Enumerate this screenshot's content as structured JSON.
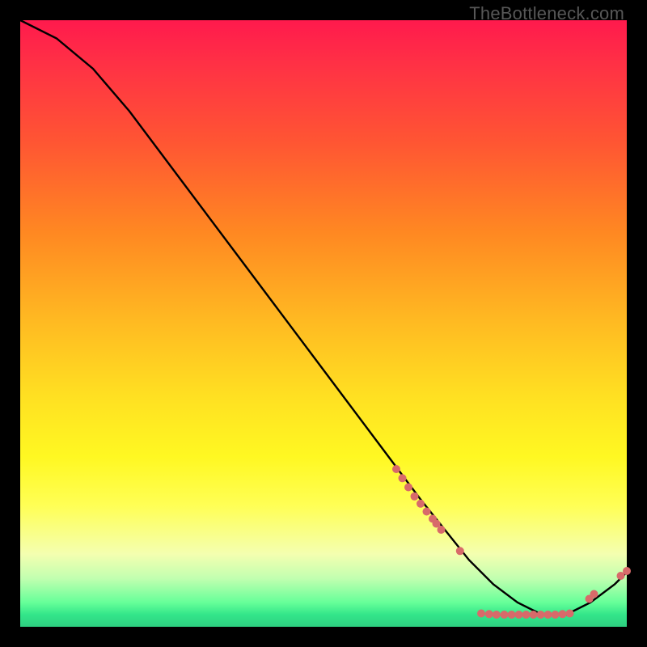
{
  "watermark": "TheBottleneck.com",
  "chart_data": {
    "type": "line",
    "title": "",
    "xlabel": "",
    "ylabel": "",
    "xlim": [
      0,
      100
    ],
    "ylim": [
      0,
      100
    ],
    "grid": false,
    "series": [
      {
        "name": "bottleneck-curve",
        "color": "#000000",
        "x": [
          0,
          6,
          12,
          18,
          24,
          30,
          36,
          42,
          48,
          54,
          60,
          66,
          70,
          74,
          78,
          82,
          86,
          90,
          94,
          98,
          100
        ],
        "y": [
          100,
          97,
          92,
          85,
          77,
          69,
          61,
          53,
          45,
          37,
          29,
          21,
          16,
          11,
          7,
          4,
          2,
          2,
          4,
          7,
          9
        ]
      }
    ],
    "markers": {
      "name": "highlight-points",
      "color": "#d86a6a",
      "radius_px": 5,
      "points_xy": [
        [
          62,
          26
        ],
        [
          63,
          24.5
        ],
        [
          64,
          23
        ],
        [
          65,
          21.5
        ],
        [
          66,
          20.3
        ],
        [
          67,
          19
        ],
        [
          68,
          17.8
        ],
        [
          68.6,
          17
        ],
        [
          69.4,
          16
        ],
        [
          72.5,
          12.5
        ],
        [
          76,
          2.2
        ],
        [
          77.3,
          2.1
        ],
        [
          78.5,
          2.0
        ],
        [
          79.8,
          2.0
        ],
        [
          81,
          2.0
        ],
        [
          82.2,
          2.0
        ],
        [
          83.4,
          2.0
        ],
        [
          84.6,
          2.0
        ],
        [
          85.8,
          2.0
        ],
        [
          87,
          2.0
        ],
        [
          88.2,
          2.0
        ],
        [
          89.4,
          2.1
        ],
        [
          90.6,
          2.2
        ],
        [
          93.8,
          4.6
        ],
        [
          94.6,
          5.4
        ],
        [
          99,
          8.4
        ],
        [
          100,
          9.2
        ]
      ]
    }
  }
}
